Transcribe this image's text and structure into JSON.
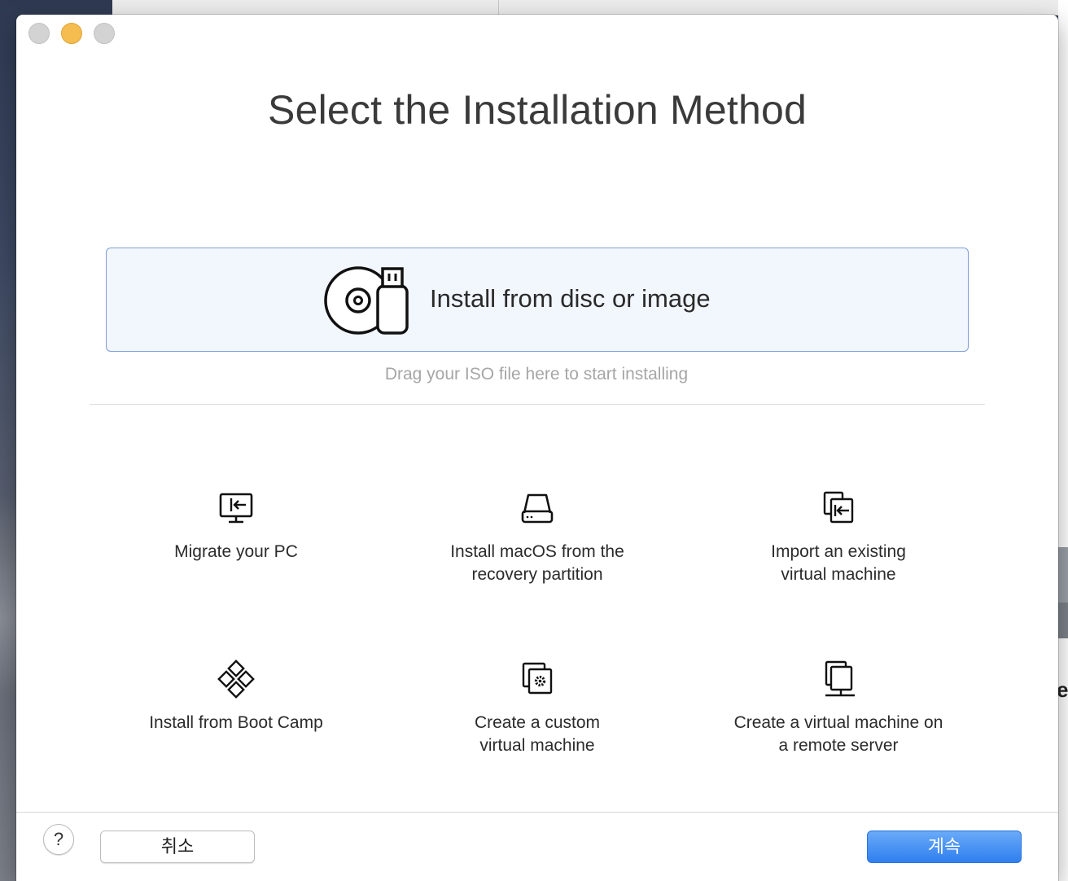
{
  "window": {
    "title": "Select the Installation Method"
  },
  "primary_option": {
    "label": "Install from disc or image",
    "icon": "disc-usb-icon",
    "hint": "Drag your ISO file here to start installing"
  },
  "options": [
    {
      "label": "Migrate your PC",
      "icon": "migrate-pc-icon"
    },
    {
      "label": "Install macOS from the\nrecovery partition",
      "icon": "hard-drive-icon"
    },
    {
      "label": "Import an existing\nvirtual machine",
      "icon": "import-vm-icon"
    },
    {
      "label": "Install from Boot Camp",
      "icon": "boot-camp-icon"
    },
    {
      "label": "Create a custom\nvirtual machine",
      "icon": "custom-vm-icon"
    },
    {
      "label": "Create a virtual machine on\na remote server",
      "icon": "remote-server-icon"
    }
  ],
  "footer": {
    "help_label": "?",
    "cancel_label": "취소",
    "continue_label": "계속"
  },
  "colors": {
    "accent": "#2f7ff0",
    "primary_option_bg": "#f2f6fd",
    "primary_option_border": "#7f9fd6",
    "minimize_button": "#f5bd4f"
  }
}
